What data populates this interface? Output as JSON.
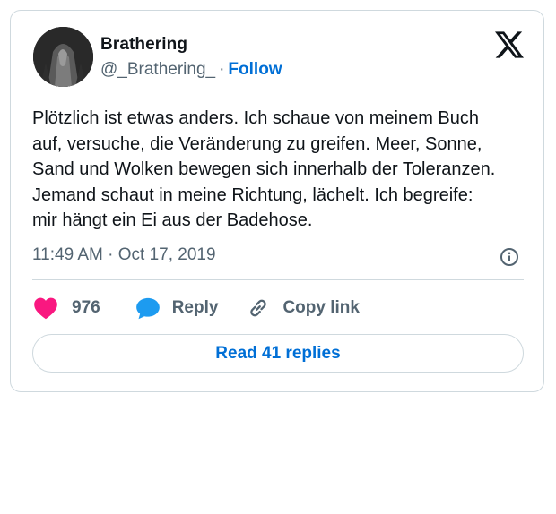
{
  "author": {
    "name": "Brathering",
    "handle": "@_Brathering_",
    "separator": "·",
    "follow_label": "Follow"
  },
  "tweet": {
    "text": "Plötzlich ist etwas anders. Ich schaue von meinem Buch\nauf, versuche, die Veränderung zu greifen. Meer, Sonne,\nSand und Wolken bewegen sich innerhalb der Toleranzen.\nJemand schaut in meine Richtung, lächelt. Ich begreife:\nmir hängt ein Ei aus der Badehose.",
    "timestamp": "11:49 AM · Oct 17, 2019"
  },
  "actions": {
    "like_count": "976",
    "reply_label": "Reply",
    "copy_link_label": "Copy link",
    "read_replies_label": "Read 41 replies"
  },
  "icons": {
    "logo": "x-logo-icon",
    "info": "info-icon",
    "like": "heart-icon",
    "reply": "speech-bubble-icon",
    "copy_link": "link-icon"
  },
  "colors": {
    "like": "#f91880",
    "reply": "#1d9bf0",
    "link": "#006fd6",
    "secondary_text": "#536471",
    "border": "#cfd9de"
  }
}
